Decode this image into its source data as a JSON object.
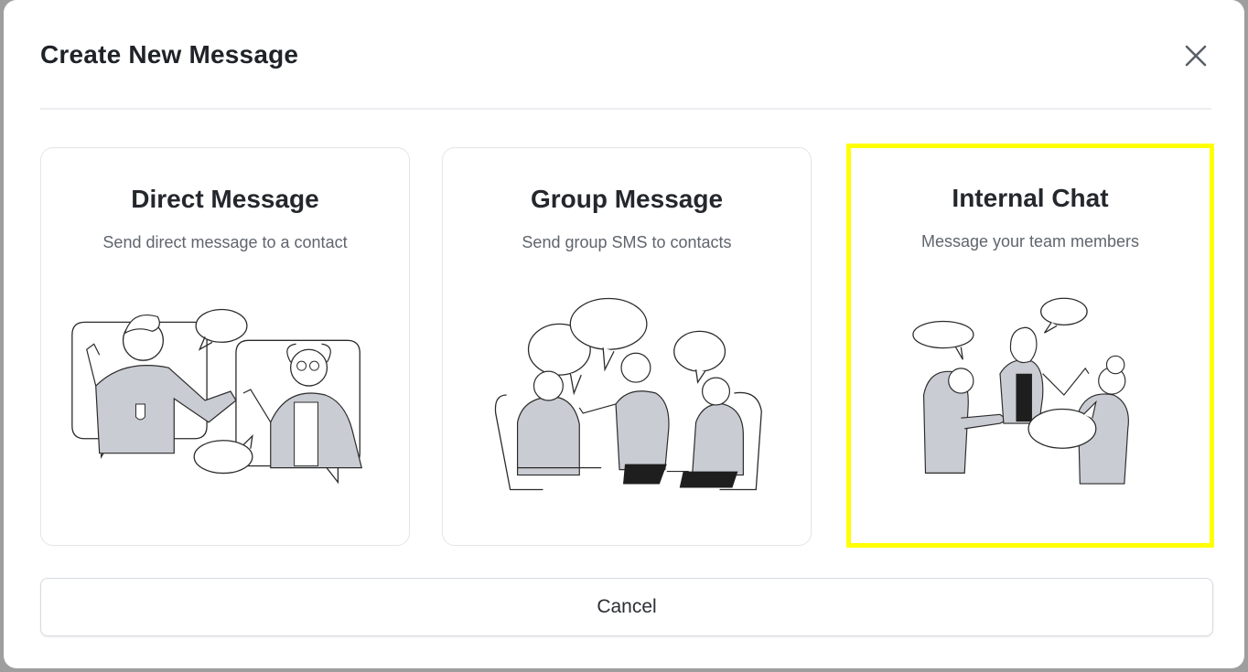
{
  "modal": {
    "title": "Create New Message",
    "close_icon": "close-icon"
  },
  "options": [
    {
      "title": "Direct Message",
      "subtitle": "Send direct message to a contact",
      "illustration": "two-people-chatting-illustration"
    },
    {
      "title": "Group Message",
      "subtitle": "Send group SMS to contacts",
      "illustration": "group-conversation-illustration"
    },
    {
      "title": "Internal Chat",
      "subtitle": "Message your team members",
      "illustration": "team-chat-illustration"
    }
  ],
  "footer": {
    "cancel_label": "Cancel"
  },
  "colors": {
    "highlight": "#ffff00",
    "figure_fill": "#c9ccd2",
    "line": "#2b2b2b"
  }
}
